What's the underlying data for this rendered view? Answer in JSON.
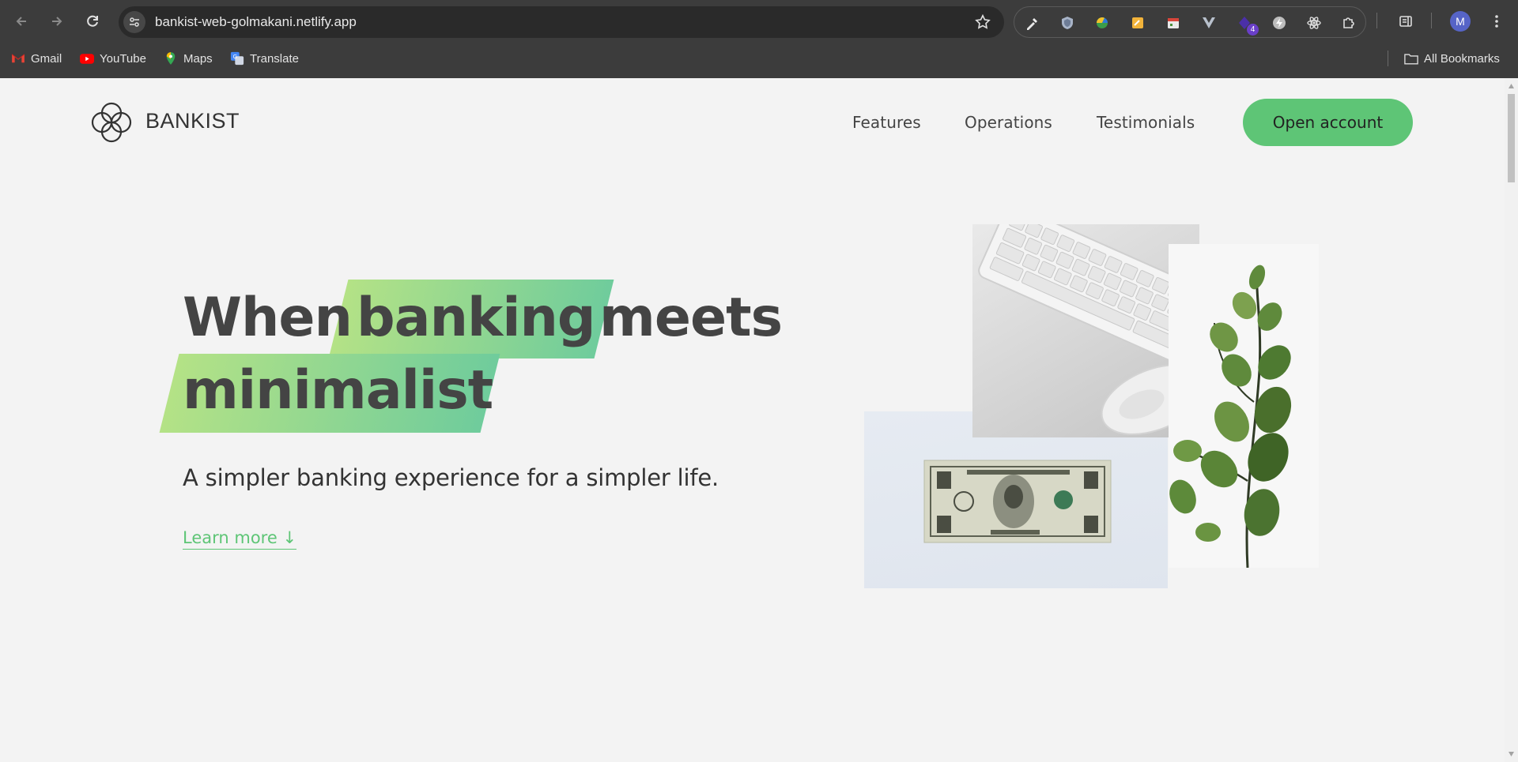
{
  "browser": {
    "url": "bankist-web-golmakani.netlify.app",
    "bookmarks": [
      {
        "label": "Gmail",
        "icon": "gmail-icon"
      },
      {
        "label": "YouTube",
        "icon": "youtube-icon"
      },
      {
        "label": "Maps",
        "icon": "maps-icon"
      },
      {
        "label": "Translate",
        "icon": "translate-icon"
      }
    ],
    "all_bookmarks_label": "All Bookmarks",
    "extension_badge": "4",
    "profile_initial": "M"
  },
  "site": {
    "brand": "BANKIST",
    "nav": {
      "features": "Features",
      "operations": "Operations",
      "testimonials": "Testimonials",
      "open_account": "Open account"
    },
    "hero": {
      "title_word_1": "When",
      "title_highlight_1": "banking",
      "title_word_2": "meets",
      "title_highlight_2": "minimalist",
      "subtitle": "A simpler banking experience for a simpler life.",
      "learn_more": "Learn more ↓"
    }
  },
  "colors": {
    "accent_green": "#5ec576",
    "highlight_start": "#b4e286",
    "highlight_end": "#6fcc9c",
    "page_bg": "#f3f3f3",
    "chrome_bg": "#3c3c3c"
  }
}
